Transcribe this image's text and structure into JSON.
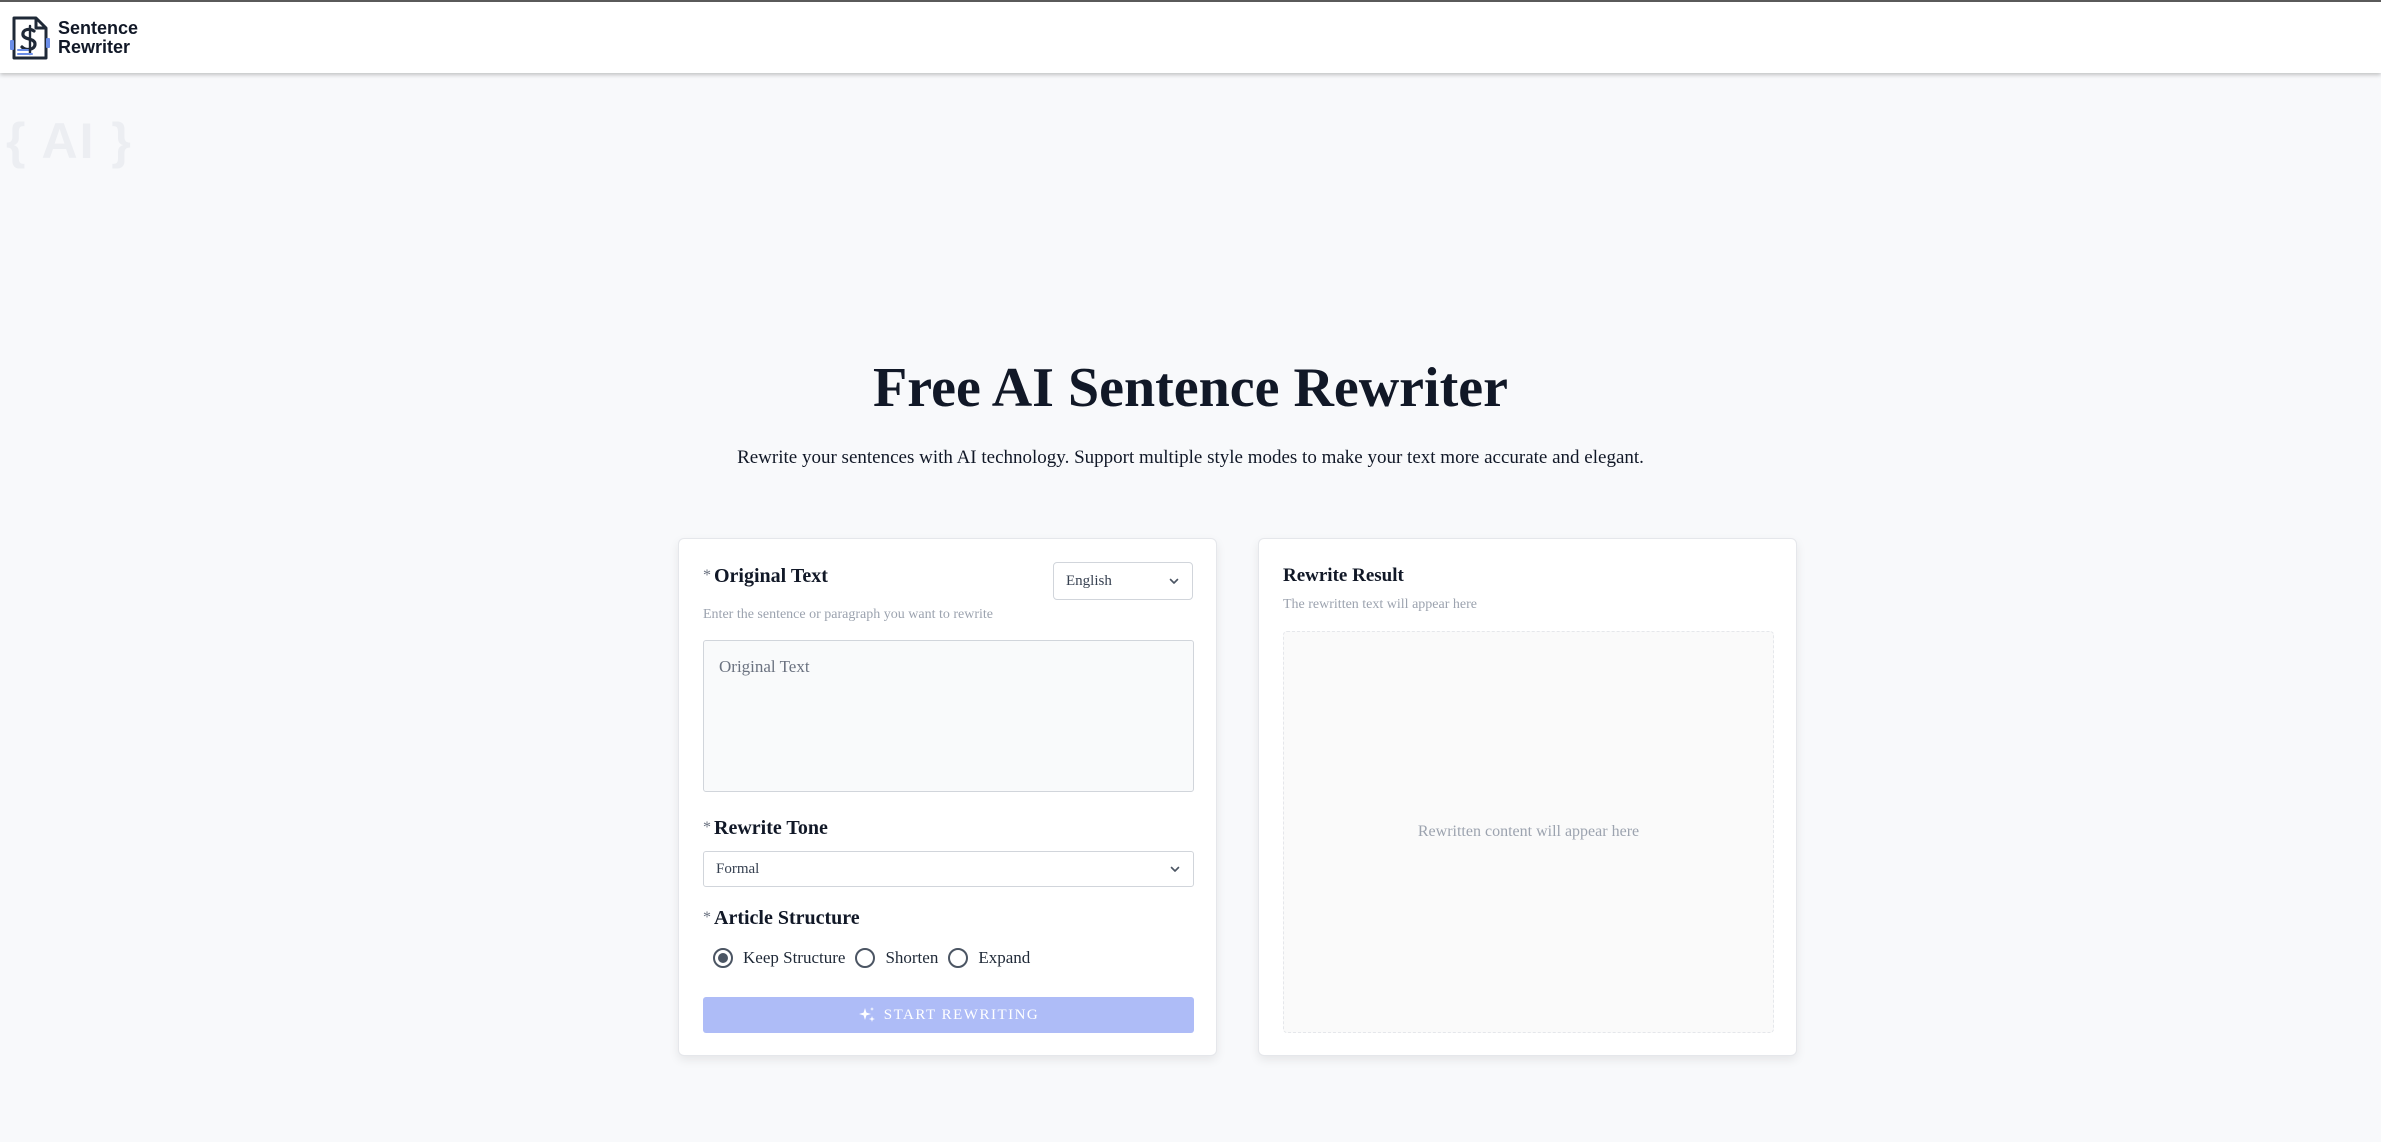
{
  "header": {
    "logo_line1": "Sentence",
    "logo_line2": "Rewriter",
    "logo_icon": "document-s-icon"
  },
  "background": {
    "watermark": "{ AI }"
  },
  "hero": {
    "title": "Free AI Sentence Rewriter",
    "subtitle": "Rewrite your sentences with AI technology. Support multiple style modes to make your text more accurate and elegant."
  },
  "form": {
    "required_mark": "*",
    "original_text_label": "Original Text",
    "original_text_hint": "Enter the sentence or paragraph you want to rewrite",
    "original_text_placeholder": "Original Text",
    "language_selected": "English",
    "tone_label": "Rewrite Tone",
    "tone_selected": "Formal",
    "structure_label": "Article Structure",
    "structure_options": [
      "Keep Structure",
      "Shorten",
      "Expand"
    ],
    "structure_selected": "Keep Structure",
    "start_button": "START REWRITING",
    "start_button_icon": "sparkle-icon"
  },
  "result": {
    "label": "Rewrite Result",
    "hint": "The rewritten text will appear here",
    "placeholder": "Rewritten content will appear here"
  },
  "colors": {
    "page_bg": "#f8f9fb",
    "button_disabled_bg": "#aebcf7",
    "title_text": "#111827",
    "hint_text": "#9ca3af"
  }
}
